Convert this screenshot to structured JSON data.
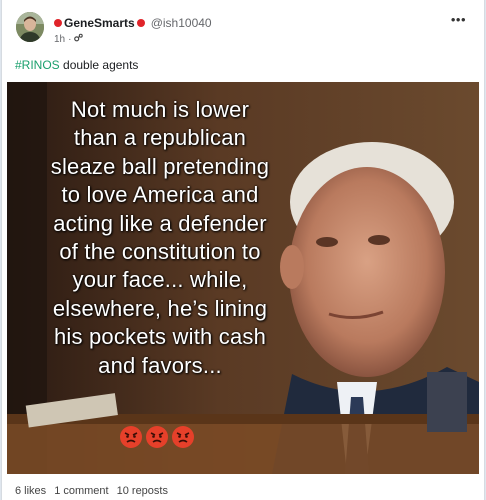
{
  "post": {
    "username": "GeneSmarts",
    "handle": "@ish10040",
    "time": "1h",
    "separator": "·",
    "hashtag": "#RINOS",
    "text": "double agents",
    "more_icon": "more-horizontal-icon"
  },
  "meme": {
    "lines": [
      "Not much is lower",
      "than a republican",
      "sleaze ball pretending",
      "to love America and",
      "acting like a defender",
      "of the constitution to",
      "your face... while,",
      "elsewhere, he’s lining",
      "his pockets with cash",
      "and favors..."
    ],
    "emoji_count": 3,
    "emoji_name": "angry-face-emoji"
  },
  "stats": {
    "likes": "6 likes",
    "comments": "1 comment",
    "reposts": "10 reposts"
  },
  "colors": {
    "status_dot": "#e0242a",
    "hashtag": "#1aa06d",
    "background": "#dfe6ee"
  }
}
